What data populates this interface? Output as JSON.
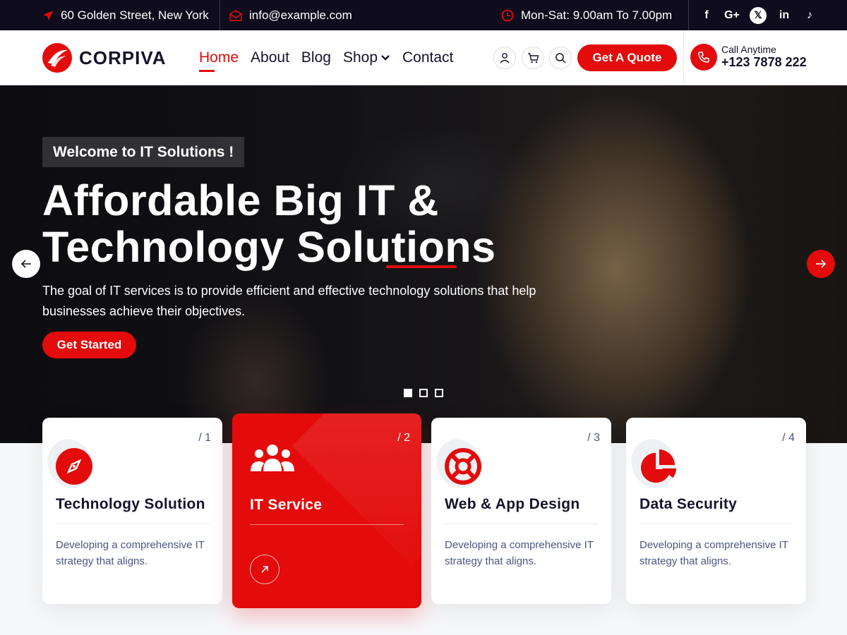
{
  "topbar": {
    "address": "60 Golden Street, New York",
    "email": "info@example.com",
    "hours": "Mon-Sat: 9.00am To 7.00pm",
    "social": [
      {
        "icon": "facebook-icon",
        "glyph": "f"
      },
      {
        "icon": "google-plus-icon",
        "glyph": "G+"
      },
      {
        "icon": "x-twitter-icon",
        "glyph": "𝕏"
      },
      {
        "icon": "linkedin-icon",
        "glyph": "in"
      },
      {
        "icon": "tiktok-icon",
        "glyph": "♪"
      }
    ]
  },
  "header": {
    "logo_text": "CORPIVA",
    "nav": [
      "Home",
      "About",
      "Blog",
      "Shop",
      "Contact"
    ],
    "quote_button": "Get A Quote",
    "call_label": "Call Anytime",
    "call_number": "+123 7878 222"
  },
  "hero": {
    "welcome": "Welcome to IT Solutions !",
    "title_line1": "Affordable Big IT &",
    "title_line2": "Technology Solutions",
    "description": "The goal of IT services is to provide efficient and effective technology solutions that help businesses achieve their objectives.",
    "cta": "Get Started"
  },
  "cards": [
    {
      "num": "/ 1",
      "title": "Technology Solution",
      "desc": "Developing a comprehensive IT strategy that aligns.",
      "icon": "compass-icon"
    },
    {
      "num": "/ 2",
      "title": "IT Service",
      "icon": "users-icon"
    },
    {
      "num": "/ 3",
      "title": "Web & App Design",
      "desc": "Developing a comprehensive IT strategy that aligns.",
      "icon": "lifebuoy-icon"
    },
    {
      "num": "/ 4",
      "title": "Data Security",
      "desc": "Developing a comprehensive IT strategy that aligns.",
      "icon": "pie-chart-icon"
    }
  ],
  "colors": {
    "accent": "#e30b0b",
    "dark": "#0f0c1d",
    "text": "#14142b"
  }
}
